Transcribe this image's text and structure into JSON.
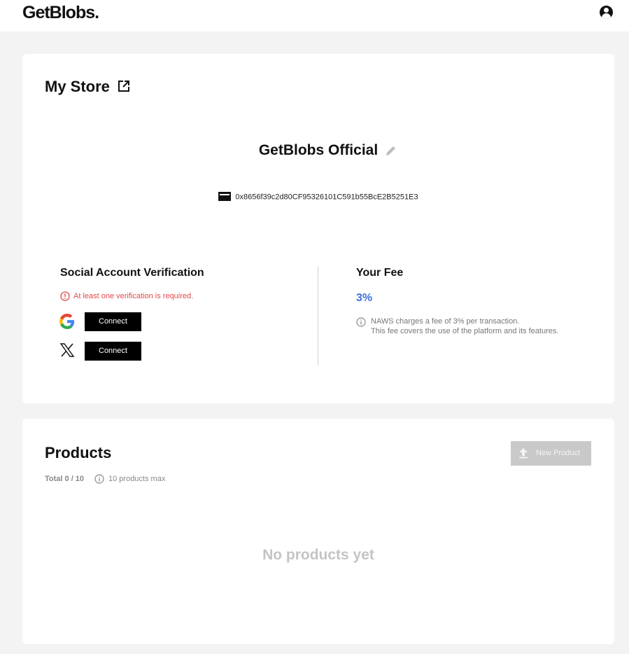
{
  "header": {
    "logo": "GetBlobs."
  },
  "store": {
    "title": "My Store",
    "name": "GetBlobs Official",
    "wallet_address": "0x8656f39c2d80CF95326101C591b55BcE2B5251E3"
  },
  "social": {
    "title": "Social Account Verification",
    "warning": "At least one verification is required.",
    "providers": [
      {
        "name": "google",
        "button_label": "Connect"
      },
      {
        "name": "x",
        "button_label": "Connect"
      }
    ]
  },
  "fee": {
    "title": "Your Fee",
    "value": "3%",
    "note_line1": "NAWS charges a fee of 3% per transaction.",
    "note_line2": "This fee covers the use of the platform and its features.",
    "accent_color": "#3b6fe0"
  },
  "products": {
    "title": "Products",
    "new_product_label": "New Product",
    "total": "Total 0 / 10",
    "max_note": "10 products max",
    "empty_message": "No products yet"
  },
  "colors": {
    "warning": "#e5484d",
    "button_dark": "#000000",
    "button_disabled": "#c9c9c9"
  },
  "icons": [
    "user-account-icon",
    "external-link-icon",
    "pencil-edit-icon",
    "wallet-icon",
    "alert-info-icon",
    "google-icon",
    "x-logo-icon",
    "info-icon",
    "upload-icon"
  ]
}
